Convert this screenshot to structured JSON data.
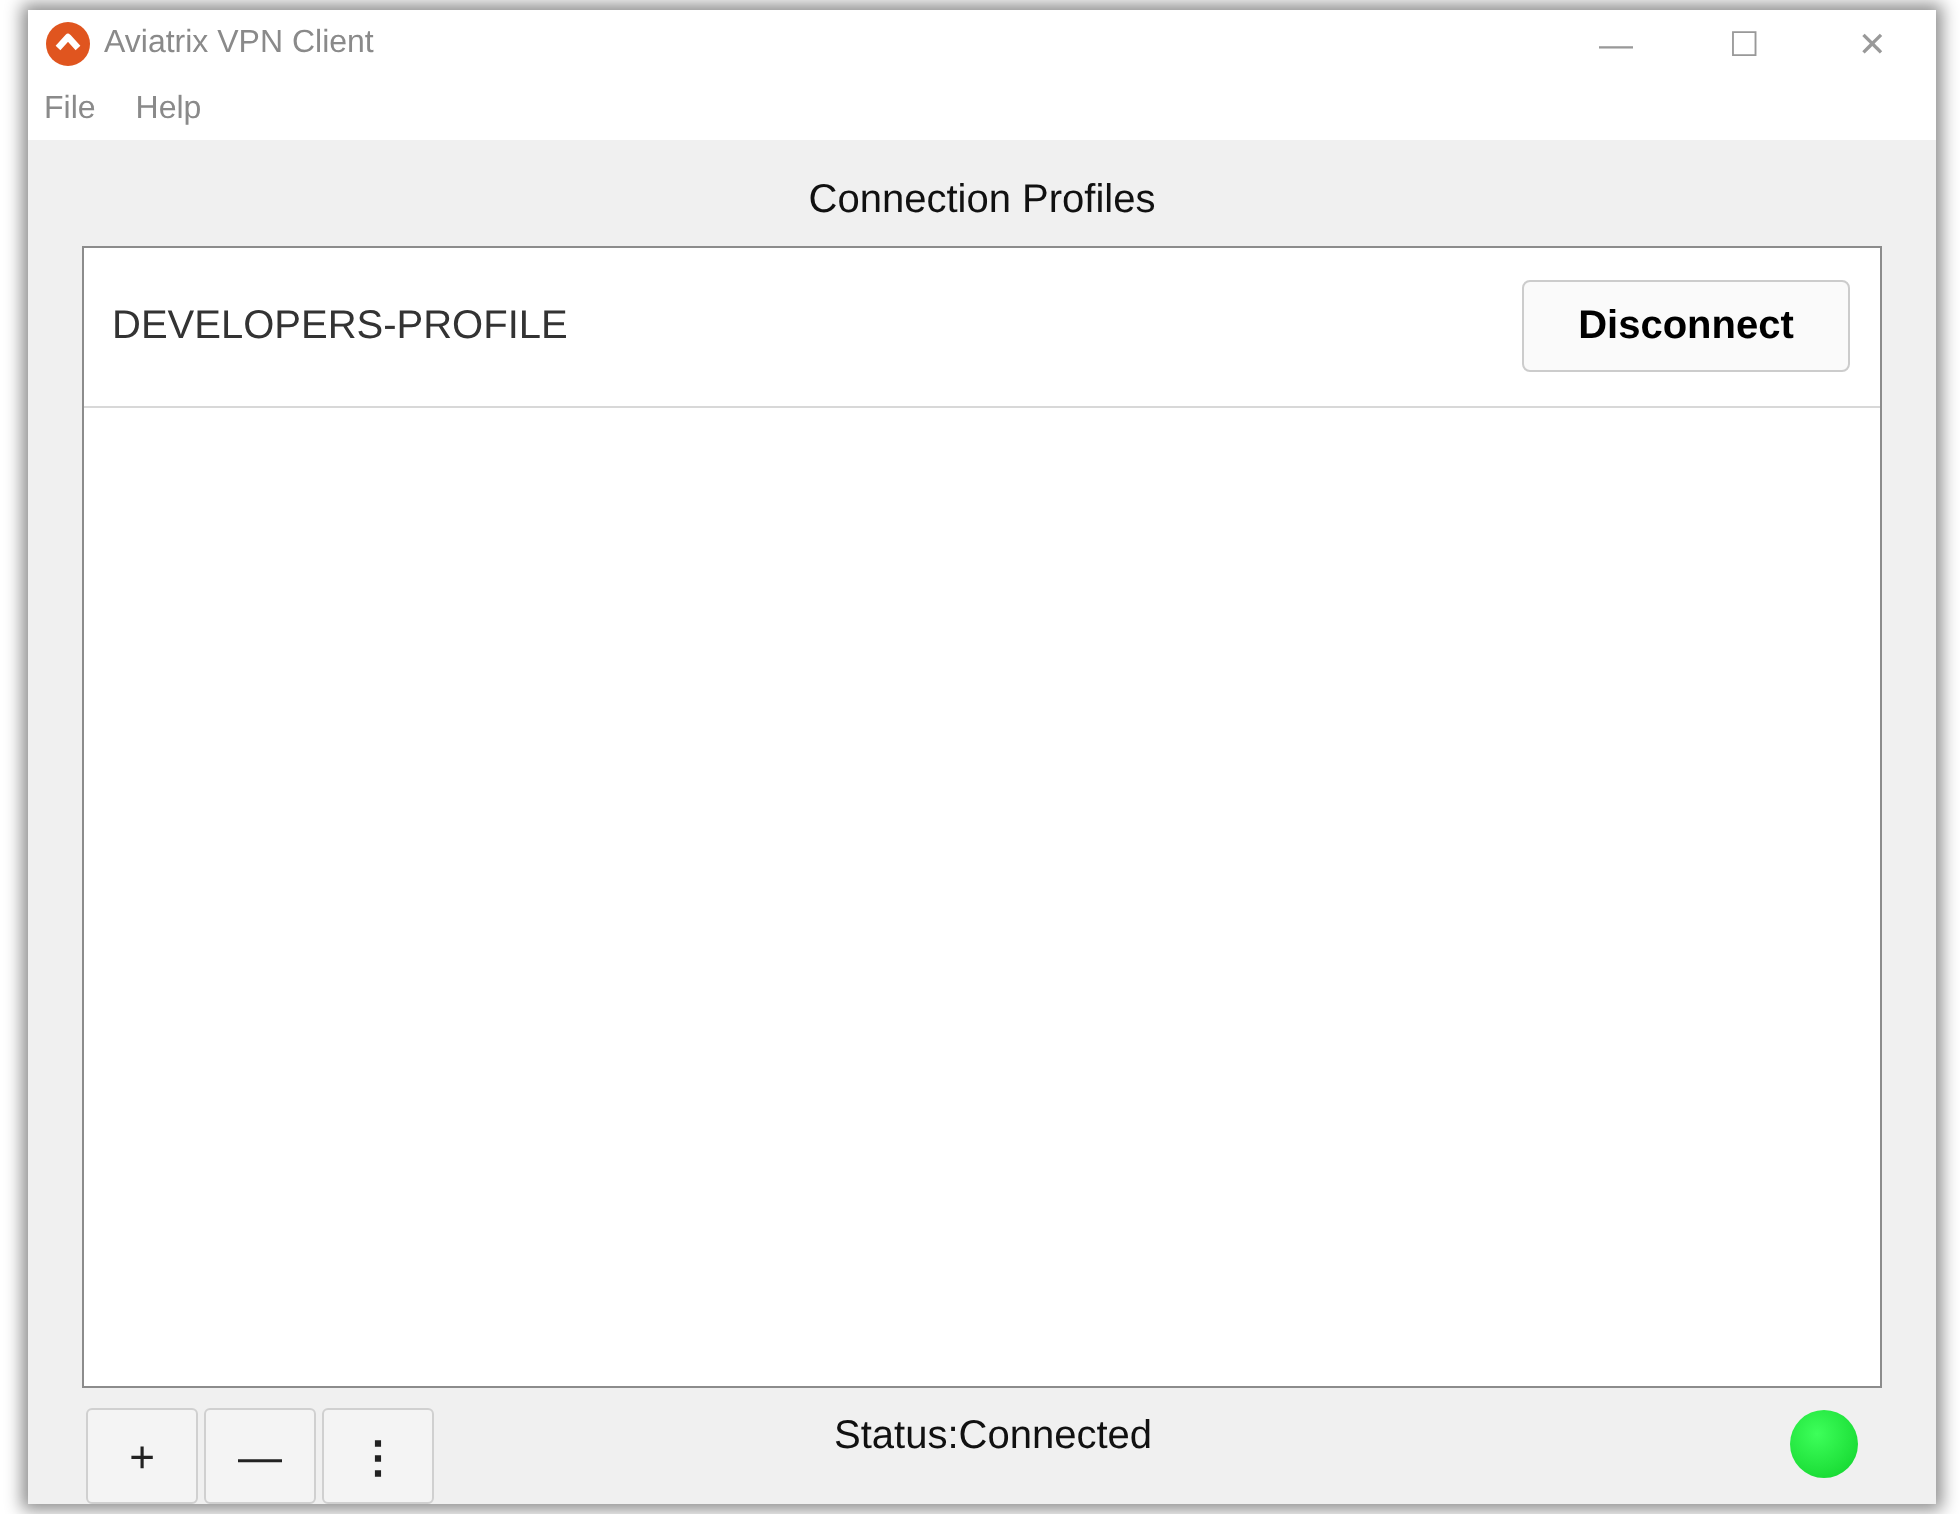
{
  "window": {
    "title": "Aviatrix VPN Client",
    "controls": [
      "—",
      "☐",
      "✕"
    ]
  },
  "menu": [
    "File",
    "Help"
  ],
  "heading": "Connection Profiles",
  "profiles": [
    {
      "name": "DEVELOPERS-PROFILE",
      "action": "Disconnect",
      "connected": true
    }
  ],
  "toolbar": [
    {
      "label": "+",
      "kind": "add"
    },
    {
      "label": "—",
      "kind": "remove"
    },
    {
      "label": "⋮",
      "kind": "more"
    }
  ],
  "status": {
    "text": "Status:Connected",
    "connected": true
  }
}
